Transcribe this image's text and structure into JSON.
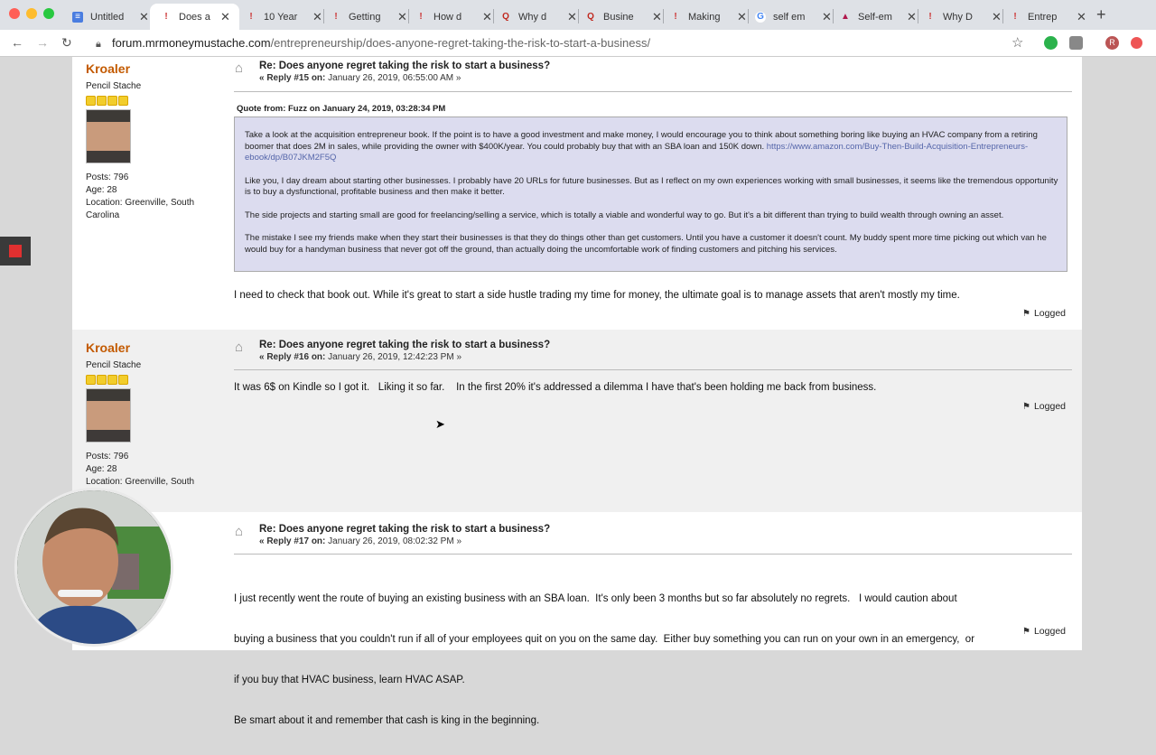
{
  "browser": {
    "tabs": [
      {
        "title": "Untitled",
        "active": false
      },
      {
        "title": "Does a",
        "active": true
      },
      {
        "title": "10 Year",
        "active": false
      },
      {
        "title": "Getting",
        "active": false
      },
      {
        "title": "How d",
        "active": false
      },
      {
        "title": "Why d",
        "active": false
      },
      {
        "title": "Busine",
        "active": false
      },
      {
        "title": "Making",
        "active": false
      },
      {
        "title": "self em",
        "active": false
      },
      {
        "title": "Self-em",
        "active": false
      },
      {
        "title": "Why D",
        "active": false
      },
      {
        "title": "Entrep",
        "active": false
      }
    ],
    "new_tab": "+",
    "url_domain": "forum.mrmoneymustache.com",
    "url_path": "/entrepreneurship/does-anyone-regret-taking-the-risk-to-start-a-business/",
    "profile_initial": "R"
  },
  "posts": [
    {
      "author": "Kroaler",
      "rank": "Pencil Stache",
      "posts": "Posts: 796",
      "age": "Age: 28",
      "location": "Location: Greenville, South Carolina",
      "subject": "Re: Does anyone regret taking the risk to start a business?",
      "reply_label": "« Reply #15 on:",
      "date": "January 26, 2019, 06:55:00 AM »",
      "quote_header": "Quote from: Fuzz on January 24, 2019, 03:28:34 PM",
      "quote": [
        "Take a look at the acquisition entrepreneur book. If the point is to have a good investment and make money, I would encourage you to think about something boring like buying an HVAC company from a retiring boomer that does 2M in sales, while providing the owner with $400K/year. You could probably buy that with an SBA loan and 150K down.",
        "Like you, I day dream about starting other businesses. I probably have 20 URLs for future businesses. But as I reflect on my own experiences working with small businesses, it seems like the tremendous opportunity is to buy a dysfunctional, profitable business and then make it better.",
        "The side projects and starting small are good for freelancing/selling a service, which is totally a viable and wonderful way to go. But it's a bit different than trying to build wealth through owning an asset.",
        "The mistake I see my friends make when they start their businesses is that they do things other than get customers. Until you have a customer it doesn't count. My buddy spent more time picking out which van he would buy for a handyman business that never got off the ground, than actually doing the uncomfortable work of finding customers and pitching his services."
      ],
      "quote_link": "https://www.amazon.com/Buy-Then-Build-Acquisition-Entrepreneurs-ebook/dp/B07JKM2F5Q",
      "body": "I need to check that book out.  While it's great to start a side hustle trading my time for money, the ultimate goal is to manage assets that aren't mostly my time.",
      "logged": "Logged"
    },
    {
      "author": "Kroaler",
      "rank": "Pencil Stache",
      "posts": "Posts: 796",
      "age": "Age: 28",
      "location": "Location: Greenville, South",
      "subject": "Re: Does anyone regret taking the risk to start a business?",
      "reply_label": "« Reply #16 on:",
      "date": "January 26, 2019, 12:42:23 PM »",
      "body": "It was 6$ on Kindle so I got it.   Liking it so far.    In the first 20% it's addressed a dilemma I have that's been holding me back from business.",
      "logged": "Logged"
    },
    {
      "subject": "Re: Does anyone regret taking the risk to start a business?",
      "reply_label": "« Reply #17 on:",
      "date": "January 26, 2019, 08:02:32 PM »",
      "body_lines": [
        "I just recently went the route of buying an existing business with an SBA loan.  It's only been 3 months but so far absolutely no regrets.   I would caution about",
        "buying a business that you couldn't run if all of your employees quit on you on the same day.  Either buy something you can run on your own in an emergency,  or",
        "if you buy that HVAC business, learn HVAC ASAP.",
        "Be smart about it and remember that cash is king in the beginning."
      ],
      "logged": "Logged"
    }
  ]
}
